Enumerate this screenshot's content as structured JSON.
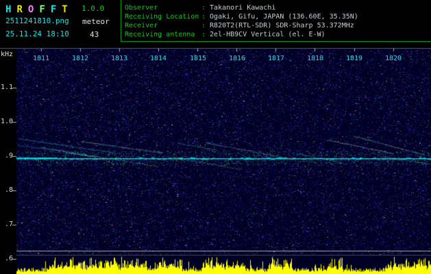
{
  "header": {
    "title_letters": [
      {
        "ch": "H",
        "color": "#00e8e8"
      },
      {
        "ch": "R",
        "color": "#e8e800"
      },
      {
        "ch": "O",
        "color": "#ff80ff"
      },
      {
        "ch": "F",
        "color": "#80ff80"
      },
      {
        "ch": "F",
        "color": "#00e8e8"
      },
      {
        "ch": "T",
        "color": "#e8e800"
      }
    ],
    "version": "1.0.0",
    "filename": "2511241810.png",
    "mode": "meteor",
    "datetime": "25.11.24 18:10",
    "count": "43"
  },
  "info": {
    "rows": [
      {
        "label": "Observer",
        "sep": ":",
        "value": "Takanori Kawachi"
      },
      {
        "label": "Receiving Location",
        "sep": ":",
        "value": "Ogaki, Gifu, JAPAN (136.60E, 35.35N)"
      },
      {
        "label": "Receiver",
        "sep": ":",
        "value": "R820T2(RTL-SDR) SDR-Sharp 53.372MHz"
      },
      {
        "label": "Receiving antenna",
        "sep": ":",
        "value": "2el-HB9CV Vertical (el. E-W)"
      }
    ]
  },
  "chart_data": {
    "type": "heatmap",
    "subtype": "radio-meteor-spectrogram",
    "ylabel": "kHz",
    "y_ticks": [
      "1.1",
      "1.0",
      ".9",
      ".8",
      ".7",
      ".6"
    ],
    "y_tick_values": [
      1.1,
      1.0,
      0.9,
      0.8,
      0.7,
      0.6
    ],
    "ylim": [
      0.55,
      1.17
    ],
    "x_ticks": [
      "1811",
      "1812",
      "1813",
      "1814",
      "1815",
      "1816",
      "1817",
      "1818",
      "1819",
      "1820"
    ],
    "time_span": "18:10-18:20",
    "carrier_khz": 0.9,
    "noise_floor_lines_khz": [
      0.624,
      0.612
    ],
    "echo_traces": [
      {
        "t1": 1810.4,
        "f1": 0.952,
        "t2": 1812.9,
        "f2": 0.91,
        "hot": false,
        "bright": 0.5
      },
      {
        "t1": 1810.4,
        "f1": 0.932,
        "t2": 1811.6,
        "f2": 0.916,
        "hot": false,
        "bright": 0.4
      },
      {
        "t1": 1811.0,
        "f1": 0.926,
        "t2": 1814.0,
        "f2": 0.87,
        "hot": true,
        "bright": 0.55
      },
      {
        "t1": 1812.0,
        "f1": 0.944,
        "t2": 1814.1,
        "f2": 0.91,
        "hot": true,
        "bright": 0.75
      },
      {
        "t1": 1811.6,
        "f1": 0.912,
        "t2": 1812.4,
        "f2": 0.898,
        "hot": false,
        "bright": 1.0
      },
      {
        "t1": 1814.4,
        "f1": 0.896,
        "t2": 1816.1,
        "f2": 0.862,
        "hot": true,
        "bright": 0.5
      },
      {
        "t1": 1814.5,
        "f1": 0.938,
        "t2": 1815.5,
        "f2": 0.918,
        "hot": false,
        "bright": 0.5
      },
      {
        "t1": 1815.2,
        "f1": 0.94,
        "t2": 1817.5,
        "f2": 0.89,
        "hot": true,
        "bright": 0.6
      },
      {
        "t1": 1817.5,
        "f1": 0.908,
        "t2": 1818.7,
        "f2": 0.882,
        "hot": false,
        "bright": 0.5
      },
      {
        "t1": 1818.3,
        "f1": 0.948,
        "t2": 1820.0,
        "f2": 0.908,
        "hot": true,
        "bright": 0.7
      },
      {
        "t1": 1819.0,
        "f1": 0.958,
        "t2": 1820.8,
        "f2": 0.904,
        "hot": true,
        "bright": 0.7
      },
      {
        "t1": 1819.7,
        "f1": 0.9,
        "t2": 1821.0,
        "f2": 0.876,
        "hot": false,
        "bright": 0.5
      }
    ],
    "signal_level_panel": {
      "position": "bottom",
      "color": "#ffff00",
      "high_activity_times": [
        [
          1811.2,
          1813.7
        ],
        [
          1813.9,
          1814.6
        ],
        [
          1815.1,
          1816.2
        ],
        [
          1816.8,
          1817.4
        ],
        [
          1818.3,
          1818.7
        ],
        [
          1819.8,
          1821.0
        ]
      ]
    }
  },
  "style": {
    "accent_cyan": "#00e8e8",
    "accent_green": "#00cc00",
    "value_text": "#c4d0d0",
    "plot_bg": "#000024",
    "carrier_line": "#00e0e0",
    "level_graph": "#ffff00",
    "trace_cyan": "#30d0d0",
    "trace_hot": "#ff5858",
    "axis_text": "#d8d8d8"
  }
}
